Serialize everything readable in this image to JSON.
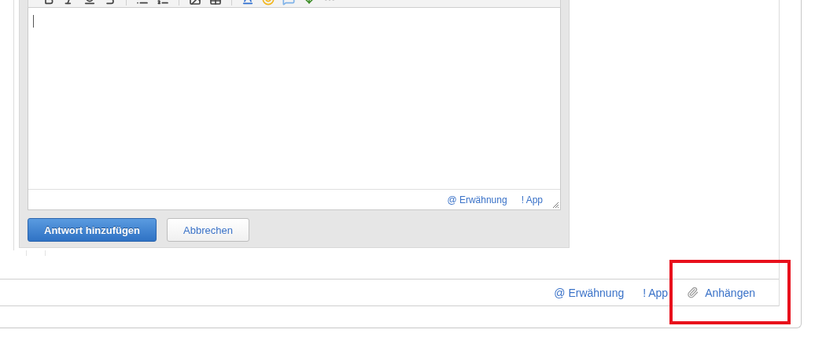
{
  "editor": {
    "links": [
      "@ Erwähnung",
      "! App"
    ],
    "buttons": [
      {
        "label": "Antwort hinzufügen",
        "kind": "primary"
      },
      {
        "label": "Abbrechen",
        "kind": "secondary"
      }
    ]
  },
  "footer": {
    "links": [
      {
        "label": "@ Erwähnung",
        "kind": "plain"
      },
      {
        "label": "! App",
        "kind": "plain"
      },
      {
        "label": "Anhängen",
        "kind": "attach"
      }
    ]
  }
}
